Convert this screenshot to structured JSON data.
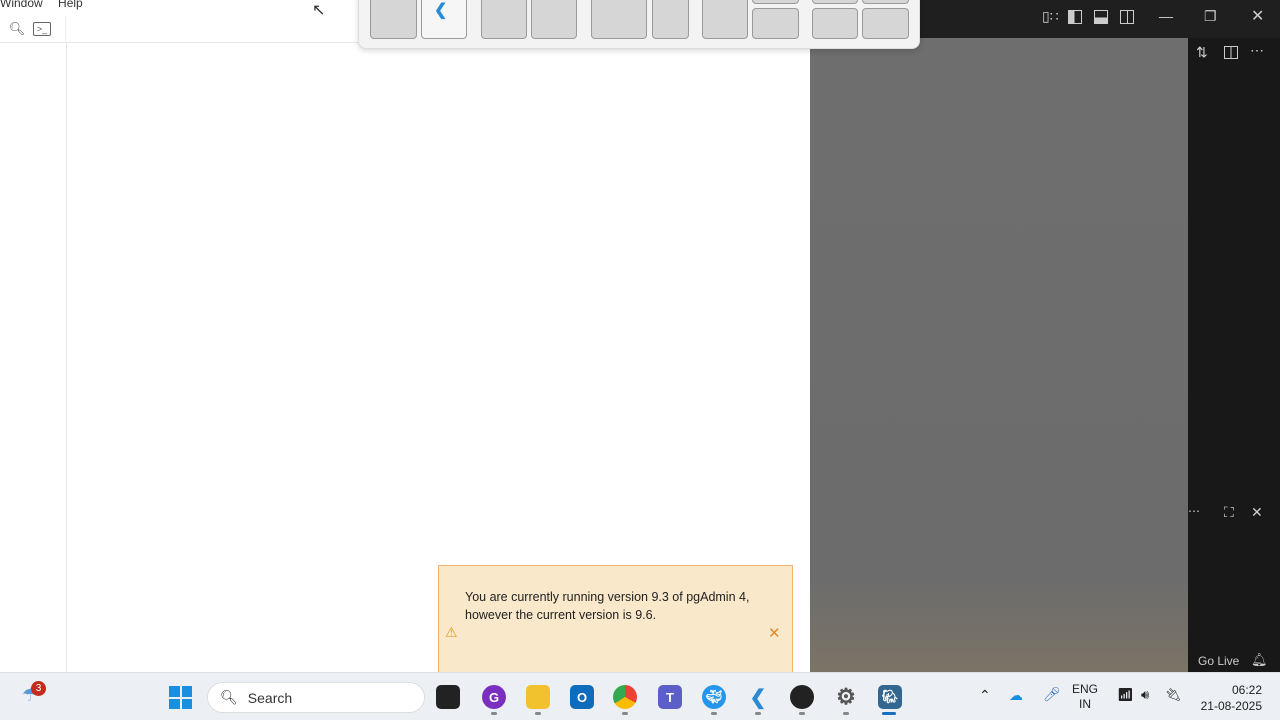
{
  "pgadmin": {
    "menu": [
      "Window",
      "Help"
    ],
    "toolbar_icons": [
      "search-icon",
      "terminal-icon"
    ]
  },
  "snap_layout": {
    "highlighted_app": "vscode"
  },
  "vscode": {
    "title_icons": [
      "customize-layout-icon",
      "toggle-sidebar-icon",
      "toggle-panel-icon",
      "toggle-secondary-sidebar-icon"
    ],
    "status_go_live": "Go Live"
  },
  "notification": {
    "message": "You are currently running version 9.3 of pgAdmin 4, however the current version is 9.6.",
    "accent": "#f0a030"
  },
  "taskbar": {
    "weather_badge": "3",
    "search_placeholder": "Search",
    "lang_line1": "ENG",
    "lang_line2": "IN",
    "time": "06:22",
    "date": "21-08-2025"
  }
}
